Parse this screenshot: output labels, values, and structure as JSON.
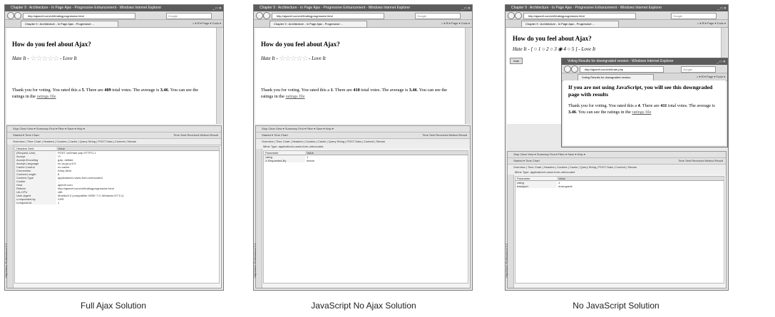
{
  "shots": [
    {
      "caption": "Full Ajax Solution",
      "window_title": "Chapter 9 : Architecture - In Page Ajax - Progressive Enhancement - Windows Internet Explorer",
      "url": "http://ajaxref.com/ch9/ratingprogressive.html",
      "search": "Google",
      "tab": "Chapter 9 : Architecture - In Page Ajax - Progressive ...",
      "heading": "How do you feel about Ajax?",
      "hate": "Hate It -",
      "love": "- Love It",
      "stars": "☆☆☆☆☆",
      "msg_pre": "Thank you for voting. You rated this a",
      "rating": "5",
      "msg_mid": ". There are",
      "votes": "409",
      "msg_mid2": "total votes. The average is",
      "avg": "3.46",
      "msg_end": ". You can see the ratings in the",
      "link": "ratings file",
      "toolbar1": "Stop   Clear   View ▾   Summary   Find ▾   Filter ▾   Save ▾   Help ▾",
      "toolbar2": "Started ▾      Time Chart",
      "toolbar2r": "Time   Sent   Received   Method   Result",
      "tabs": "Overview | Time Chart | Headers | Cookies | Cache | Query String | POST Data | Content | Stream",
      "grid_head": [
        "Headers Sent",
        "Value"
      ],
      "rows": [
        [
          "(Request-Line)",
          "POST /ch9/rate.php HTTP/1.1"
        ],
        [
          "Accept",
          "*/*"
        ],
        [
          "Accept-Encoding",
          "gzip, deflate"
        ],
        [
          "Accept-Language",
          "en-us,ja;q=0.5"
        ],
        [
          "Cache-Control",
          "no-cache"
        ],
        [
          "Connection",
          "Keep-Alive"
        ],
        [
          "Content-Length",
          "8"
        ],
        [
          "Content-Type",
          "application/x-www-form-urlencoded"
        ],
        [
          "Cookie",
          "..."
        ],
        [
          "Host",
          "ajaxref.com"
        ],
        [
          "Referer",
          "http://ajaxref.com/ch9/ratingprogressive.html"
        ],
        [
          "UA-CPU",
          "x86"
        ],
        [
          "User-Agent",
          "Mozilla/4.0 (compatible; MSIE 7.0; Windows NT 5.1)"
        ],
        [
          "x-requested-by",
          "XHR"
        ],
        [
          "x-request-id",
          "1"
        ]
      ],
      "side_label": "HttpWatch Professional 5.0"
    },
    {
      "caption": "JavaScript No Ajax Solution",
      "window_title": "Chapter 9 : Architecture - In Page Ajax - Progressive Enhancement - Windows Internet Explorer",
      "url": "http://ajaxref.com/ch9/ratingprogressive.html",
      "search": "Google",
      "tab": "Chapter 9 : Architecture - In Page Ajax - Progressive ...",
      "heading": "How do you feel about Ajax?",
      "hate": "Hate It -",
      "love": "- Love It",
      "stars": "☆☆☆☆☆",
      "msg_pre": "Thank you for voting. You rated this a",
      "rating": "1",
      "msg_mid": ". There are",
      "votes": "410",
      "msg_mid2": "total votes. The average is",
      "avg": "3.46",
      "msg_end": ". You can see the ratings in the",
      "link": "ratings file",
      "toolbar1": "Stop   Clear   View ▾   Summary   Find ▾   Filter ▾   Save ▾   Help ▾",
      "toolbar2": "Started ▾      Time Chart",
      "toolbar2r": "Time   Sent   Received   Method   Result",
      "tabs": "Overview | Time Chart | Headers | Cookies | Cache | Query String | POST Data | Content | Stream",
      "mime": "Mime Type:  application/x-www-form-urlencoded",
      "grid_head": [
        "Parameter",
        "Value"
      ],
      "rows": [
        [
          "rating",
          "1"
        ],
        [
          "X-Requested-By",
          "iframe"
        ]
      ],
      "side_label": "HttpWatch Professional 5.0"
    },
    {
      "caption": "No JavaScript Solution",
      "window_title": "Chapter 9 : Architecture - In Page Ajax - Progressive Enhancement - Windows Internet Explorer",
      "url": "http://ajaxref.com/ch9/ratingprogressive.html",
      "search": "Google",
      "tab": "Chapter 9 : Architecture - In Page Ajax - Progressive ...",
      "heading": "How do you feel about Ajax?",
      "radios": "Hate It - [ ○ 1 ○ 2 ○ 3 ◉ 4 ○ 5 ] - Love It",
      "vote": "Vote",
      "popup_title": "Voting Results for downgraded version - Windows Internet Explorer",
      "popup_url": "http://ajaxref.com/ch9/rate.php",
      "popup_tab": "Voting Results for downgraded version",
      "popup_heading": "If you are not using JavaScript, you will see this downgraded page with results",
      "msg_pre": "Thank you for voting. You rated this a",
      "rating": "4",
      "msg_mid": ". There are",
      "votes": "411",
      "msg_mid2": "total votes. The average is",
      "avg": "3.46",
      "msg_end": ". You can see the ratings in the",
      "link": "ratings file",
      "toolbar1": "Stop   Clear   View ▾   Summary   Find ▾   Filter ▾   Save ▾   Help ▾",
      "toolbar2": "Started ▾      Time Chart",
      "toolbar2r": "Time   Sent   Received   Method   Result",
      "tabs": "Overview | Time Chart | Headers | Cookies | Cache | Query String | POST Data | Content | Stream",
      "mime": "Mime Type:  application/x-www-form-urlencoded",
      "grid_head": [
        "Parameter",
        "Value"
      ],
      "rows": [
        [
          "rating",
          "4"
        ],
        [
          "transport",
          "downgrade"
        ]
      ],
      "side_label": "HttpWatch Professional 5.0"
    }
  ]
}
